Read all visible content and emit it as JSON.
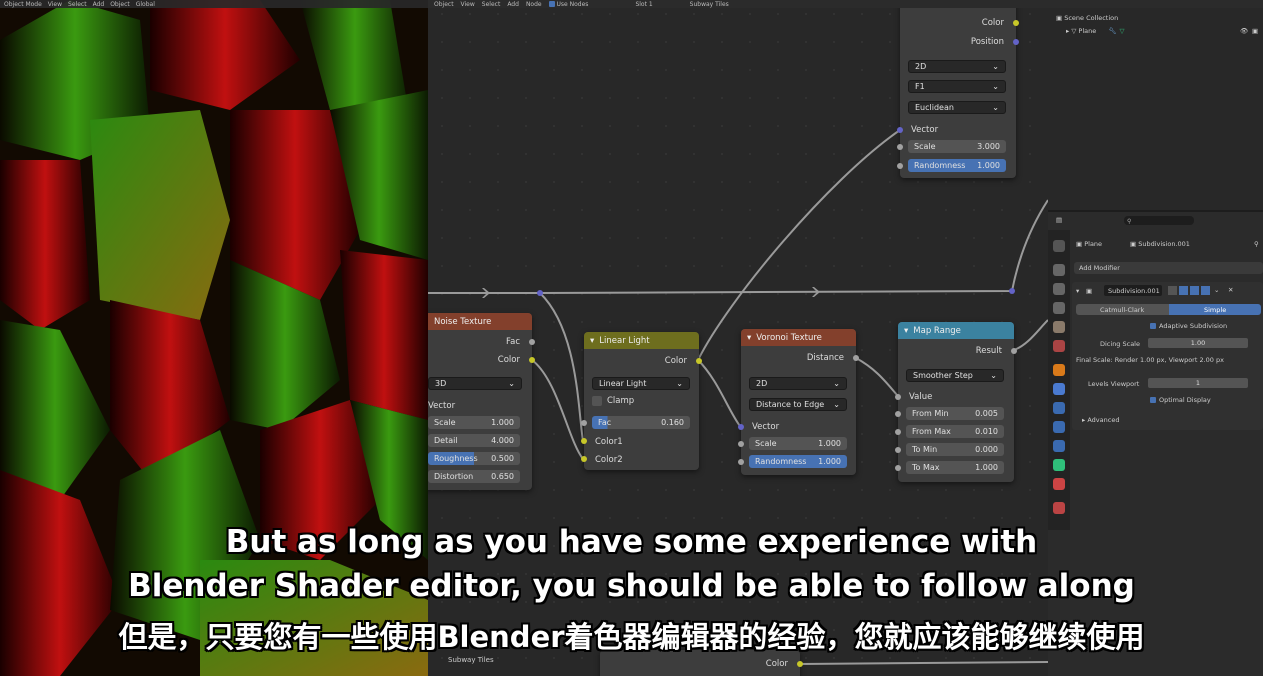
{
  "viewport": {
    "header_items": [
      "Object Mode",
      "View",
      "Select",
      "Add",
      "Object",
      "Global"
    ]
  },
  "node_editor": {
    "header_items": [
      "Object",
      "View",
      "Select",
      "Add",
      "Node",
      "Use Nodes",
      "Slot 1",
      "Subway Tiles"
    ],
    "material_label": "Subway Tiles",
    "nodes": {
      "top_voronoi": {
        "outputs": [
          "Color",
          "Position"
        ],
        "dimensions": "2D",
        "feature": "F1",
        "metric": "Euclidean",
        "input_vector": "Vector",
        "scale_label": "Scale",
        "scale_value": "3.000",
        "randomness_label": "Randomness",
        "randomness_value": "1.000"
      },
      "noise": {
        "title": "Noise Texture",
        "outputs": [
          "Fac",
          "Color"
        ],
        "dimensions": "3D",
        "input_vector": "Vector",
        "fields": [
          {
            "label": "Scale",
            "value": "1.000"
          },
          {
            "label": "Detail",
            "value": "4.000"
          },
          {
            "label": "Roughness",
            "value": "0.500"
          },
          {
            "label": "Distortion",
            "value": "0.650"
          }
        ]
      },
      "linear_light": {
        "title": "Linear Light",
        "output": "Color",
        "blend_mode": "Linear Light",
        "clamp_label": "Clamp",
        "fac_label": "Fac",
        "fac_value": "0.160",
        "inputs": [
          "Color1",
          "Color2"
        ]
      },
      "voronoi": {
        "title": "Voronoi Texture",
        "output": "Distance",
        "dimensions": "2D",
        "feature": "Distance to Edge",
        "input_vector": "Vector",
        "scale_label": "Scale",
        "scale_value": "1.000",
        "randomness_label": "Randomness",
        "randomness_value": "1.000"
      },
      "map_range": {
        "title": "Map Range",
        "output": "Result",
        "interpolation": "Smoother Step",
        "input_value": "Value",
        "fields": [
          {
            "label": "From Min",
            "value": "0.005"
          },
          {
            "label": "From Max",
            "value": "0.010"
          },
          {
            "label": "To Min",
            "value": "0.000"
          },
          {
            "label": "To Max",
            "value": "1.000"
          }
        ]
      },
      "bottom": {
        "output": "Color"
      }
    }
  },
  "outliner": {
    "title": "Scene Collection",
    "item": "Plane"
  },
  "properties": {
    "object_name": "Plane",
    "modifier_name": "Subdivision.001",
    "add_modifier": "Add Modifier",
    "modifier_field": "Subdivision.001",
    "method_catmull": "Catmull-Clark",
    "method_simple": "Simple",
    "adaptive_label": "Adaptive Subdivision",
    "dicing_label": "Dicing Scale",
    "dicing_value": "1.00",
    "final_scale": "Final Scale: Render 1.00 px, Viewport 2.00 px",
    "levels_label": "Levels Viewport",
    "levels_value": "1",
    "optimal_label": "Optimal Display",
    "advanced_label": "Advanced"
  },
  "subtitles": {
    "line1": "But as long as you have some experience with",
    "line2": "Blender Shader editor, you should be able to follow along",
    "line3": "但是，只要您有一些使用Blender着色器编辑器的经验，您就应该能够继续使用"
  },
  "colors": {
    "noise_header": "#83402c",
    "mix_header": "#6e6e1e",
    "voronoi_header": "#83402c",
    "map_range_header": "#3b82a0",
    "accent_blue": "#4772b3"
  }
}
